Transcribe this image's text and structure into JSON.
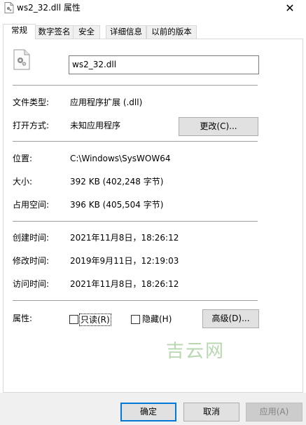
{
  "window": {
    "title": "ws2_32.dll 属性",
    "close_glyph": "✕"
  },
  "tabs": [
    {
      "label": "常规",
      "active": true
    },
    {
      "label": "数字签名",
      "active": false
    },
    {
      "label": "安全",
      "active": false
    },
    {
      "label": "详细信息",
      "active": false
    },
    {
      "label": "以前的版本",
      "active": false
    }
  ],
  "general": {
    "file_name": "ws2_32.dll",
    "file_type_label": "文件类型:",
    "file_type_value": "应用程序扩展 (.dll)",
    "opens_with_label": "打开方式:",
    "opens_with_value": "未知应用程序",
    "change_button": "更改(C)...",
    "location_label": "位置:",
    "location_value": "C:\\Windows\\SysWOW64",
    "size_label": "大小:",
    "size_value": "392 KB (402,248 字节)",
    "size_on_disk_label": "占用空间:",
    "size_on_disk_value": "396 KB (405,504 字节)",
    "created_label": "创建时间:",
    "created_value": "2021年11月8日，18:26:12",
    "modified_label": "修改时间:",
    "modified_value": "2019年9月11日，12:19:03",
    "accessed_label": "访问时间:",
    "accessed_value": "2021年11月8日，18:26:12",
    "attributes_label": "属性:",
    "readonly_label": "只读(R)",
    "readonly_checked": false,
    "hidden_label": "隐藏(H)",
    "hidden_checked": false,
    "advanced_button": "高级(D)..."
  },
  "watermark": "吉云网",
  "footer": {
    "ok_button": "确定",
    "cancel_button": "取消",
    "apply_button": "应用(A)"
  },
  "colors": {
    "accent_focus": "#0078d7",
    "separator": "#a0a0a0"
  }
}
